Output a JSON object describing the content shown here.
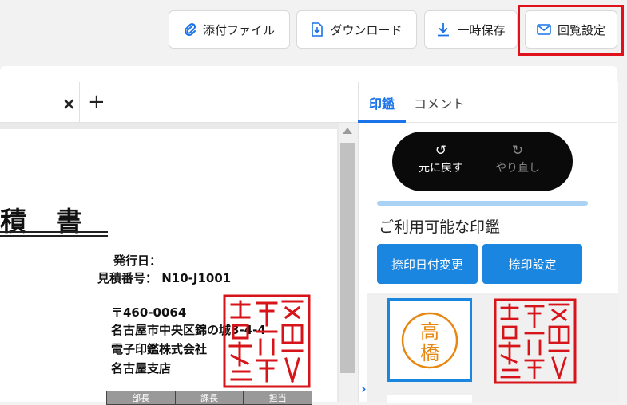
{
  "toolbar": {
    "attach_label": "添付ファイル",
    "download_label": "ダウンロード",
    "save_label": "一時保存",
    "circulate_label": "回覧設定"
  },
  "document": {
    "tab_close": "×",
    "tab_add": "+",
    "title": "積　書",
    "issue_date_label": "発行日：",
    "estimate_no": "見積番号： N10-J1001",
    "postal": "〒460-0064",
    "address": "名古屋市中央区錦の城3-4-4",
    "company": "電子印鑑株式会社",
    "branch": "名古屋支店",
    "table_headers": [
      "部長",
      "課長",
      "担当"
    ]
  },
  "side": {
    "tabs": [
      "印鑑",
      "コメント"
    ],
    "undo_label": "元に戻す",
    "redo_label": "やり直し",
    "available_title": "ご利用可能な印鑑",
    "date_change_label": "捺印日付変更",
    "seal_setting_label": "捺印設定",
    "personal_seal": [
      "高",
      "橋"
    ]
  },
  "colors": {
    "accent": "#1a86e0",
    "highlight": "#e0121b",
    "seal_red": "#d7141a",
    "seal_orange": "#e8870f"
  }
}
